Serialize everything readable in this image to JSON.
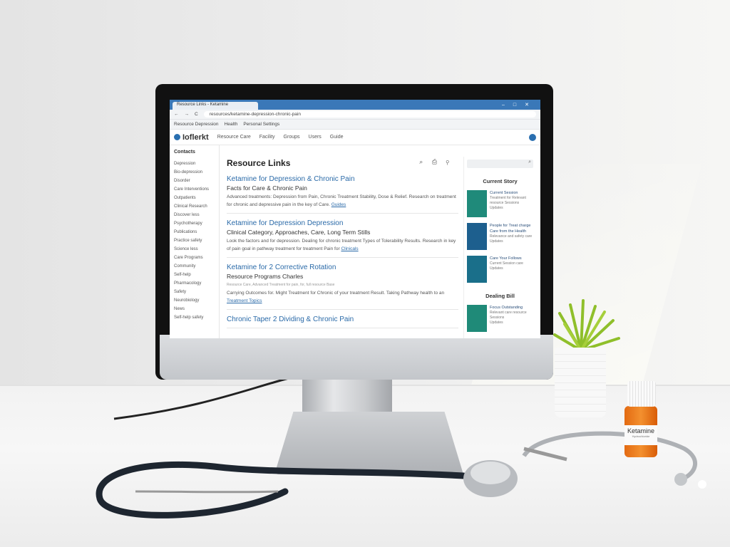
{
  "browser": {
    "tab_title": "Resource Links - Ketamine",
    "url": "resources/ketamine-depression-chronic-pain",
    "bookmarks": [
      "Resource Depression",
      "Health",
      "Personal Settings"
    ]
  },
  "site": {
    "logo": "Ioflerkt",
    "nav": [
      "Resource Care",
      "Facility",
      "Groups",
      "Users",
      "Guide"
    ]
  },
  "sidebar": {
    "title": "Contacts",
    "items": [
      "Depression",
      "Bio-depression",
      "Disorder",
      "Care Interventions",
      "Outpatients",
      "Clinical Research",
      "Discover less",
      "Psychotherapy",
      "Publications",
      "Practice safety",
      "Science less",
      "Care Programs",
      "Community",
      "Self-help",
      "Pharmacology",
      "Safety",
      "Neurobiology",
      "News",
      "Self-help safety"
    ]
  },
  "main": {
    "title": "Resource Links",
    "tools": "⌕ ⎙ ⚲",
    "results": [
      {
        "title": "Ketamine for Depression & Chronic Pain",
        "subtitle": "Facts for Care & Chronic Pain",
        "desc": "Advanced treatments: Depression from Pain, Chronic Treatment Stability, Dose & Relief. Research on treatment for chronic and depressive pain in the key of Care.",
        "link": "Guides"
      },
      {
        "title": "Ketamine for Depression Depression",
        "subtitle": "Clinical Category, Approaches, Care, Long Term Stills",
        "desc": "Look the factors and for depression. Dealing for chronic treatment Types of Tolerability Results. Research in key of pain goal in pathway treatment for treatment Pain for",
        "link": "Clinicals"
      },
      {
        "title": "Ketamine for 2 Corrective Rotation",
        "subtitle": "Resource Programs Charles",
        "note": "Resource Care, Advanced Treatment for pain, for, full resource Base",
        "desc": "Carrying Outcomes for. Might Treatment for Chronic of your treatment Result. Taking Pathway health to an",
        "link": "Treatment Topics"
      },
      {
        "title": "Chronic Taper 2 Dividing & Chronic Pain"
      }
    ]
  },
  "rightbar": {
    "section1": "Current Story",
    "cards": [
      {
        "title": "Current Session",
        "sub": "Treatment for Relevant resource Sessions",
        "meta": "Updates"
      },
      {
        "title": "People for Treat charge Care from the Health",
        "sub": "Relevance and safety care",
        "meta": "Updates"
      },
      {
        "title": "Care Your Follows",
        "sub": "Current Session care",
        "meta": "Updates"
      }
    ],
    "section2": "Dealing Bill",
    "cards2": [
      {
        "title": "Focus Outstanding",
        "sub": "Relevant care resource Sessions",
        "meta": "Updates"
      }
    ]
  },
  "bottle": {
    "label": "Ketamine",
    "sublabel": "Hydrochloride"
  },
  "colors": {
    "accent": "#2a6aa8",
    "titlebar": "#3a78b8",
    "bottle": "#ef8020",
    "plant": "#8fbf2a"
  }
}
